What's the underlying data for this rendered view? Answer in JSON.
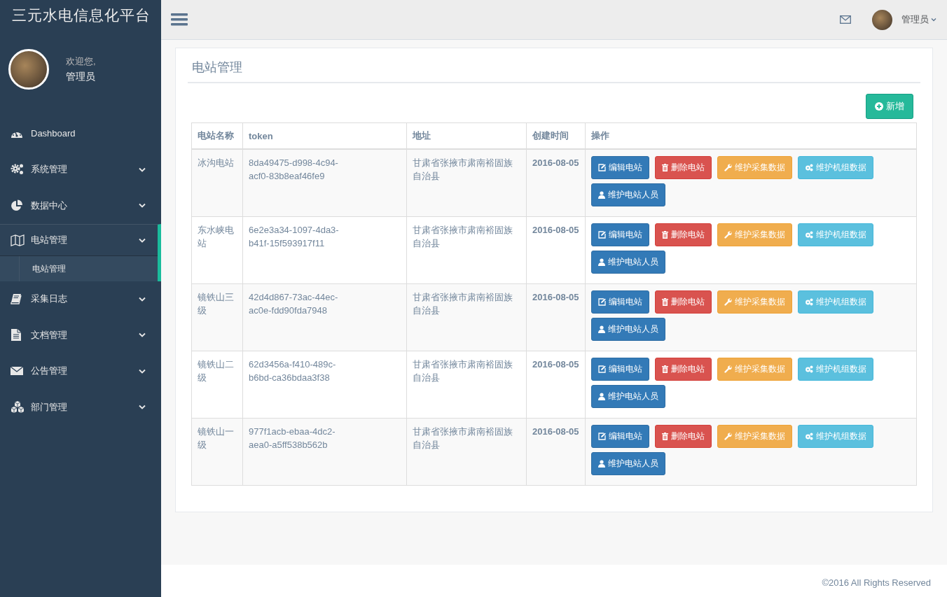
{
  "sidebar": {
    "brand": "三元水电信息化平台",
    "welcome": "欢迎您,",
    "user": "管理员",
    "items": [
      {
        "label": "Dashboard"
      },
      {
        "label": "系统管理",
        "expanded": false
      },
      {
        "label": "数据中心",
        "expanded": false
      },
      {
        "label": "电站管理",
        "expanded": true,
        "children": [
          {
            "label": "电站管理",
            "selected": true
          }
        ]
      },
      {
        "label": "采集日志",
        "expanded": false
      },
      {
        "label": "文档管理",
        "expanded": false
      },
      {
        "label": "公告管理",
        "expanded": false
      },
      {
        "label": "部门管理",
        "expanded": false
      }
    ]
  },
  "topbar": {
    "user": "管理员"
  },
  "panel": {
    "title": "电站管理",
    "add_button": "新增",
    "table": {
      "columns": [
        "电站名称",
        "token",
        "地址",
        "创建时间",
        "操作"
      ],
      "rows": [
        {
          "name": "冰沟电站",
          "token": "8da49475-d998-4c94-acf0-83b8eaf46fe9",
          "address": "甘肃省张掖市肃南裕固族自治县",
          "created": "2016-08-05",
          "actions": [
            {
              "kind": "edit",
              "label": "编辑电站"
            },
            {
              "kind": "delete",
              "label": "删除电站"
            },
            {
              "kind": "collect",
              "label": "维护采集数据"
            },
            {
              "kind": "units",
              "label": "维护机组数据"
            },
            {
              "kind": "staff",
              "label": "维护电站人员"
            }
          ]
        },
        {
          "name": "东水峡电站",
          "token": "6e2e3a34-1097-4da3-b41f-15f593917f11",
          "address": "甘肃省张掖市肃南裕固族自治县",
          "created": "2016-08-05",
          "actions": [
            {
              "kind": "edit",
              "label": "编辑电站"
            },
            {
              "kind": "delete",
              "label": "删除电站"
            },
            {
              "kind": "collect",
              "label": "维护采集数据"
            },
            {
              "kind": "units",
              "label": "维护机组数据"
            },
            {
              "kind": "staff",
              "label": "维护电站人员"
            }
          ]
        },
        {
          "name": "镜铁山三级",
          "token": "42d4d867-73ac-44ec-ac0e-fdd90fda7948",
          "address": "甘肃省张掖市肃南裕固族自治县",
          "created": "2016-08-05",
          "actions": [
            {
              "kind": "edit",
              "label": "编辑电站"
            },
            {
              "kind": "delete",
              "label": "删除电站"
            },
            {
              "kind": "collect",
              "label": "维护采集数据"
            },
            {
              "kind": "units",
              "label": "维护机组数据"
            },
            {
              "kind": "staff",
              "label": "维护电站人员"
            }
          ]
        },
        {
          "name": "镜铁山二级",
          "token": "62d3456a-f410-489c-b6bd-ca36bdaa3f38",
          "address": "甘肃省张掖市肃南裕固族自治县",
          "created": "2016-08-05",
          "actions": [
            {
              "kind": "edit",
              "label": "编辑电站"
            },
            {
              "kind": "delete",
              "label": "删除电站"
            },
            {
              "kind": "collect",
              "label": "维护采集数据"
            },
            {
              "kind": "units",
              "label": "维护机组数据"
            },
            {
              "kind": "staff",
              "label": "维护电站人员"
            }
          ]
        },
        {
          "name": "镜铁山一级",
          "token": "977f1acb-ebaa-4dc2-aea0-a5ff538b562b",
          "address": "甘肃省张掖市肃南裕固族自治县",
          "created": "2016-08-05",
          "actions": [
            {
              "kind": "edit",
              "label": "编辑电站"
            },
            {
              "kind": "delete",
              "label": "删除电站"
            },
            {
              "kind": "collect",
              "label": "维护采集数据"
            },
            {
              "kind": "units",
              "label": "维护机组数据"
            },
            {
              "kind": "staff",
              "label": "维护电站人员"
            }
          ]
        }
      ]
    }
  },
  "footer": {
    "text": "©2016 All Rights Reserved"
  }
}
